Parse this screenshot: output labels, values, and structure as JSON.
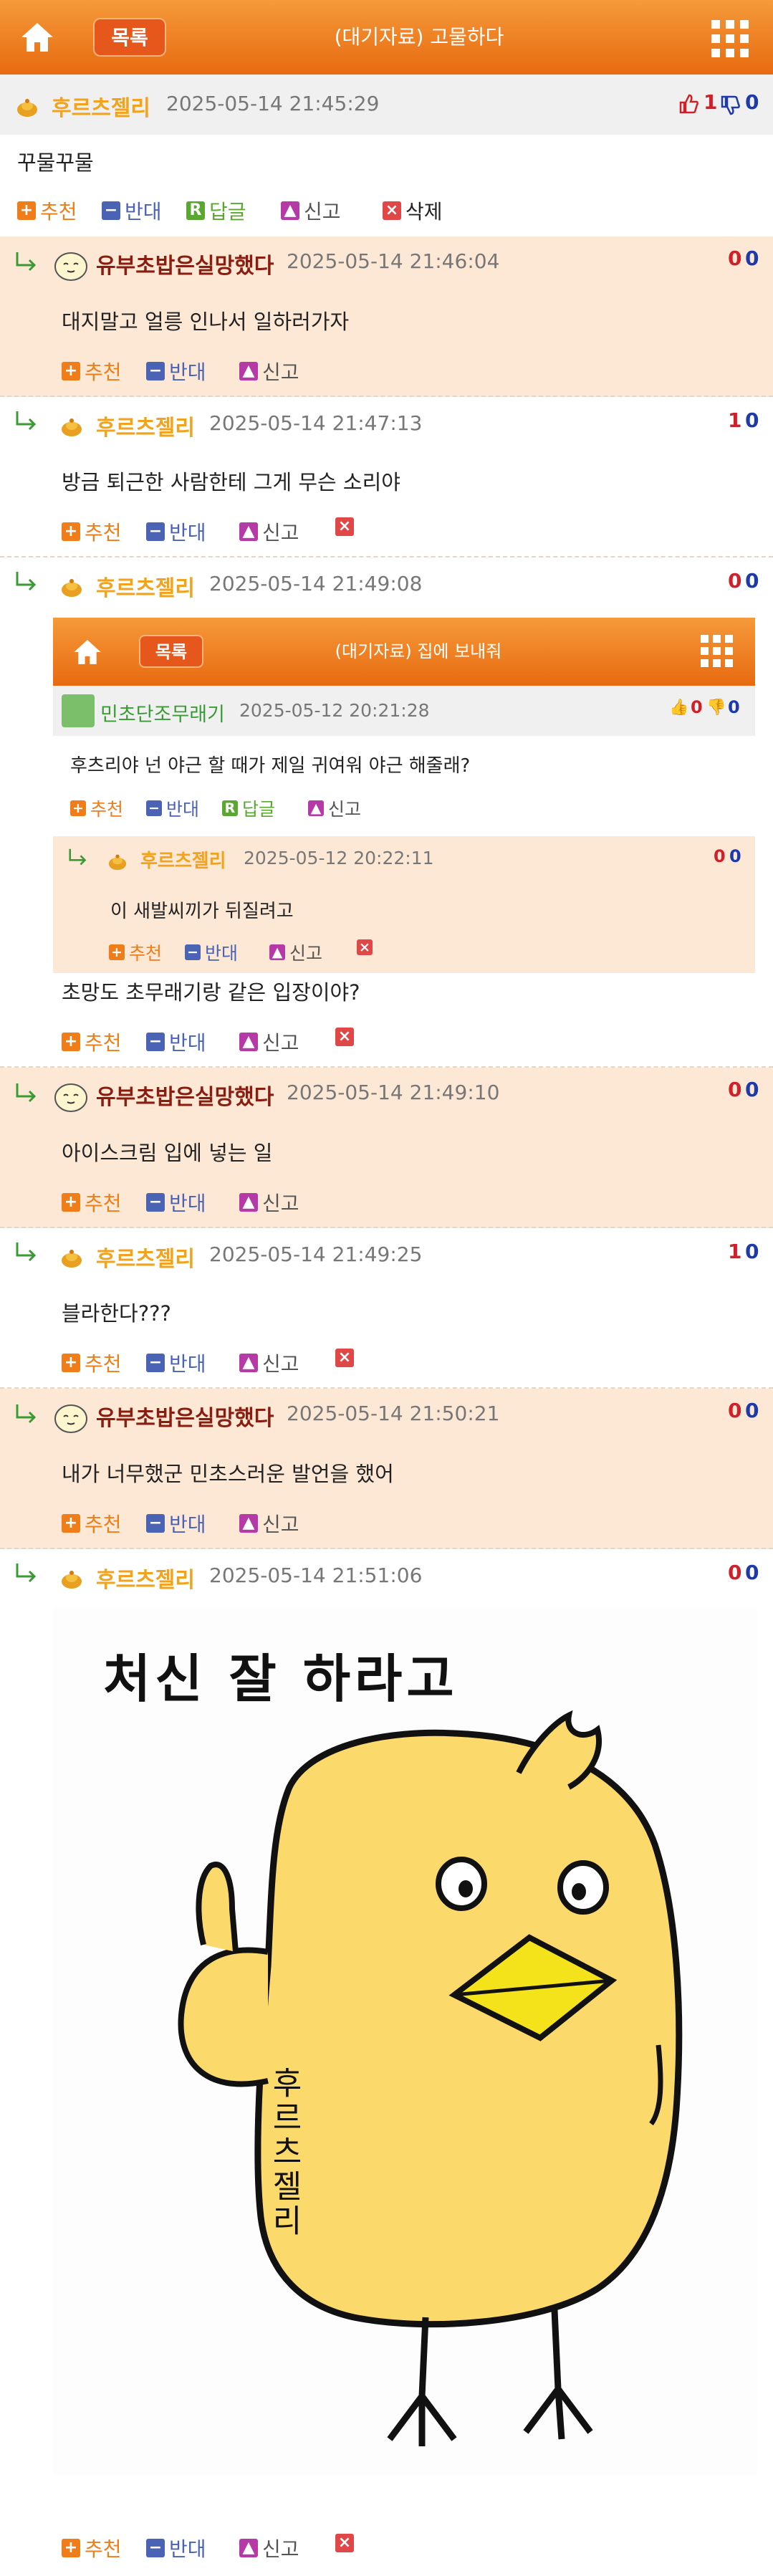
{
  "header": {
    "list_label": "목록",
    "title": "(대기자료) 고물하다"
  },
  "post": {
    "author": "후르츠젤리",
    "date": "2025-05-14 21:45:29",
    "up": "1",
    "down": "0",
    "body": "꾸물꾸물",
    "actions": {
      "up": "추천",
      "down": "반대",
      "reply": "답글",
      "report": "신고",
      "delete": "삭제"
    }
  },
  "actions": {
    "up": "추천",
    "down": "반대",
    "reply": "답글",
    "report": "신고"
  },
  "comments": [
    {
      "author": "유부초밥은실망했다",
      "date": "2025-05-14 21:46:04",
      "up": "0",
      "down": "0",
      "text": "대지말고 얼릉 인나서 일하러가자"
    },
    {
      "author": "후르츠젤리",
      "date": "2025-05-14 21:47:13",
      "up": "1",
      "down": "0",
      "text": "방금 퇴근한 사람한테 그게 무슨 소리야"
    },
    {
      "author": "후르츠젤리",
      "date": "2025-05-14 21:49:08",
      "up": "0",
      "down": "0",
      "text": "초망도 초무래기랑 같은 입장이야?"
    },
    {
      "author": "유부초밥은실망했다",
      "date": "2025-05-14 21:49:10",
      "up": "0",
      "down": "0",
      "text": "아이스크림 입에 넣는 일"
    },
    {
      "author": "후르츠젤리",
      "date": "2025-05-14 21:49:25",
      "up": "1",
      "down": "0",
      "text": "블라한다???"
    },
    {
      "author": "유부초밥은실망했다",
      "date": "2025-05-14 21:50:21",
      "up": "0",
      "down": "0",
      "text": "내가 너무했군 민초스러운 발언을 했어"
    },
    {
      "author": "후르츠젤리",
      "date": "2025-05-14 21:51:06",
      "up": "0",
      "down": "0"
    }
  ],
  "embed": {
    "list_label": "목록",
    "title": "(대기자료) 집에 보내줘",
    "author": "민초단조무래기",
    "date": "2025-05-12 20:21:28",
    "up": "0",
    "down": "0",
    "body": "후츠리야 넌 야근 할 때가 제일 귀여워 야근 해줄래?",
    "reply": {
      "author": "후르츠젤리",
      "date": "2025-05-12 20:22:11",
      "up": "0",
      "down": "0",
      "text": "이 새발씨끼가 뒤질려고"
    }
  },
  "drawing": {
    "caption": "처신 잘 하라고",
    "signature": "후르츠젤리"
  },
  "colors": {
    "header_orange": "#e86a10",
    "nick_orange": "#f2a31b",
    "nick_red": "#8a1d10",
    "comment_alt_bg": "#fde8d6",
    "up_red": "#d0202a",
    "down_blue": "#1d3aa8"
  }
}
